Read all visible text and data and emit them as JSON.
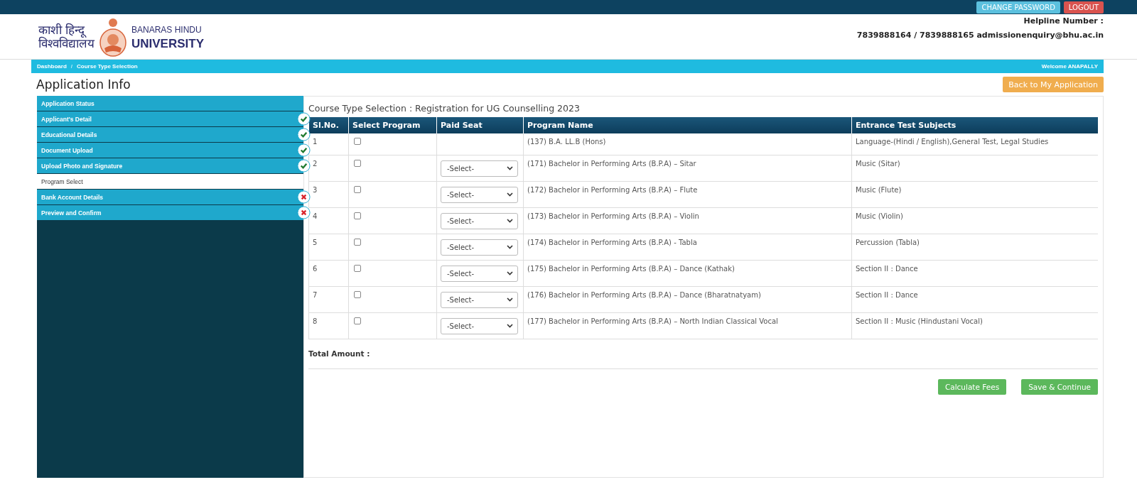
{
  "top_bar": {
    "buttons": [
      {
        "label": "CHANGE PASSWORD",
        "kind": "info"
      },
      {
        "label": "LOGOUT",
        "kind": "danger"
      }
    ]
  },
  "header": {
    "logo_hindi_line1": "काशी हिन्दू",
    "logo_hindi_line2": "विश्वविद्यालय",
    "logo_english_line1": "BANARAS HINDU",
    "logo_english_line2": "UNIVERSITY",
    "helpline_label": "Helpline Number :",
    "helpline_contact": "7839888164 / 7839888165 admissionenquiry@bhu.ac.in"
  },
  "breadcrumb": {
    "items": [
      "Dashboard",
      "Course Type Selection"
    ],
    "separator": "/",
    "welcome": "Welcome ANAPALLY"
  },
  "page_title": "Application Info",
  "back_button": "Back to My Application",
  "sidebar": {
    "items": [
      {
        "label": "Application Status",
        "selected": false,
        "kind": "plain"
      },
      {
        "label": "Applicant's Detail",
        "selected": false,
        "kind": "done"
      },
      {
        "label": "Educational Details",
        "selected": false,
        "kind": "done"
      },
      {
        "label": "Document Upload",
        "selected": false,
        "kind": "done"
      },
      {
        "label": "Upload Photo and Signature",
        "selected": false,
        "kind": "done"
      },
      {
        "label": "Program Select",
        "selected": true,
        "kind": "plain"
      },
      {
        "label": "Bank Account Details",
        "selected": false,
        "kind": "pending"
      },
      {
        "label": "Preview and Confirm",
        "selected": false,
        "kind": "pending"
      }
    ]
  },
  "panel_title": "Course Type Selection : Registration for UG Counselling 2023",
  "table": {
    "columns": [
      "Sl.No.",
      "Select Program",
      "Paid Seat",
      "Program Name",
      "Entrance Test Subjects"
    ],
    "rows": [
      {
        "sl": "1",
        "checked": false,
        "program": "(137) B.A. LL.B (Hons)",
        "subjects": "Language-(Hindi / English),General Test, Legal Studies"
      },
      {
        "sl": "2",
        "checked": false,
        "paid_seat": "-Select-",
        "program": "(171) Bachelor in Performing Arts (B.P.A) – Sitar",
        "subjects": "Music (Sitar)"
      },
      {
        "sl": "3",
        "checked": false,
        "paid_seat": "-Select-",
        "program": "(172) Bachelor in Performing Arts (B.P.A) – Flute",
        "subjects": "Music (Flute)"
      },
      {
        "sl": "4",
        "checked": false,
        "paid_seat": "-Select-",
        "program": "(173) Bachelor in Performing Arts (B.P.A) – Violin",
        "subjects": "Music (Violin)"
      },
      {
        "sl": "5",
        "checked": false,
        "paid_seat": "-Select-",
        "program": "(174) Bachelor in Performing Arts (B.P.A) - Tabla",
        "subjects": "Percussion (Tabla)"
      },
      {
        "sl": "6",
        "checked": false,
        "paid_seat": "-Select-",
        "program": "(175) Bachelor in Performing Arts (B.P.A) – Dance (Kathak)",
        "subjects": "Section II : Dance"
      },
      {
        "sl": "7",
        "checked": false,
        "paid_seat": "-Select-",
        "program": "(176) Bachelor in Performing Arts (B.P.A) – Dance (Bharatnatyam)",
        "subjects": "Section II : Dance"
      },
      {
        "sl": "8",
        "checked": false,
        "paid_seat": "-Select-",
        "program": "(177) Bachelor in Performing Arts (B.P.A) – North Indian Classical Vocal",
        "subjects": "Section II : Music (Hindustani Vocal)"
      }
    ]
  },
  "total_label": "Total Amount :",
  "actions": [
    "Calculate Fees",
    "Save & Continue"
  ]
}
